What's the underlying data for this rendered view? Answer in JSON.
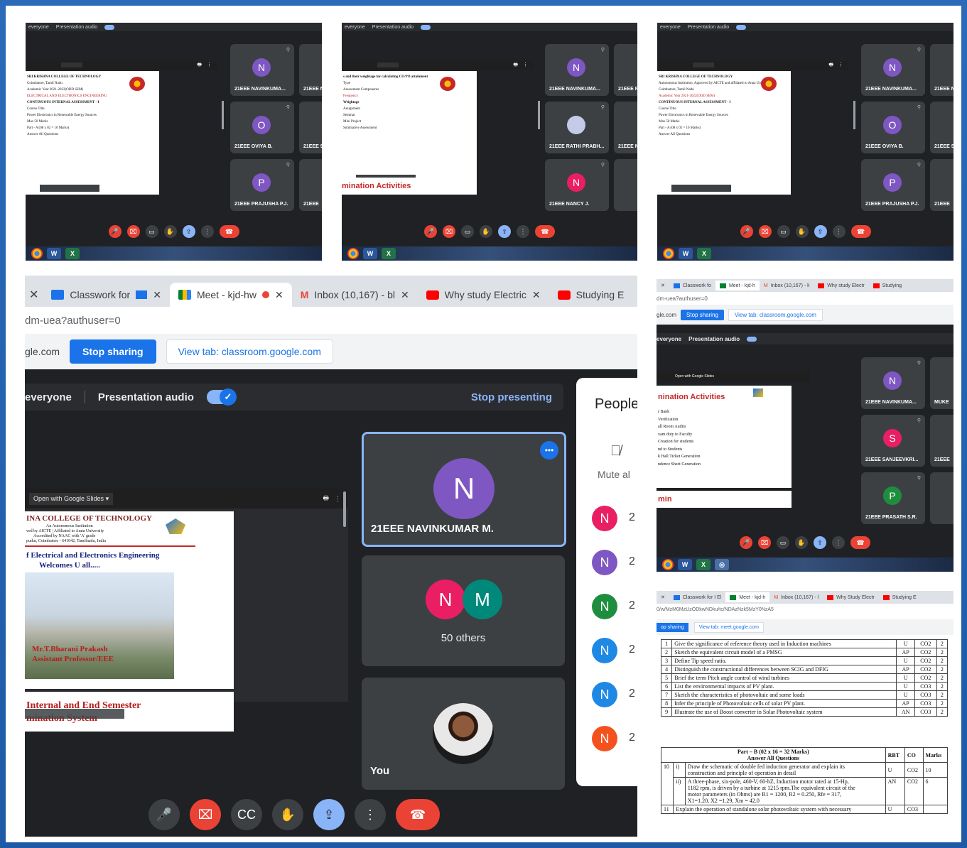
{
  "colors": {
    "accent": "#1a73e8",
    "danger": "#ea4335",
    "purple": "#7e57c2",
    "green": "#1e8e3e",
    "teal": "#00897b",
    "blue": "#1e88e5",
    "orange": "#f4511e",
    "pink": "#e91e63"
  },
  "meet_common": {
    "audience_label": "everyone",
    "presentation_audio": "Presentation audio",
    "open_with": "Open with Google Slides"
  },
  "top_panels": [
    {
      "doc_lines": [
        "SRI KRISHNA COLLEGE OF TECHNOLOGY",
        "Coimbatore, Tamil Nadu",
        "Academic Year 2021-2022(ODD SEM)",
        "ELECTRICAL AND ELECTRONICS ENGINEERING",
        "CONTINUOUS INTERNAL ASSESSMENT - I",
        "Course Title",
        "Power Electronics in Renewable Energy Sources",
        "Max 50 Marks",
        "Part - A (08 x 02 = 16 Marks)",
        "Answer All Questions"
      ],
      "tiles": [
        {
          "initial": "N",
          "name": "21EEE NAVINKUMA...",
          "color": "#7e57c2"
        },
        {
          "initial": "O",
          "name": "21EEE OVIYA B.",
          "color": "#7e57c2"
        },
        {
          "initial": "P",
          "name": "21EEE PRAJUSHA P.J.",
          "color": "#7e57c2"
        }
      ],
      "side": [
        "21EEE N",
        "21EEE S",
        "21EEE"
      ]
    },
    {
      "doc_lines": [
        "s and their weightage for calculating CO/PO attainment",
        "Type",
        "Assessment Components",
        "Frequency",
        "Weightage",
        "Assignment",
        "Seminar",
        "Mini Project",
        "Summative Assessment"
      ],
      "tiles": [
        {
          "initial": "N",
          "name": "21EEE NAVINKUMA...",
          "color": "#7e57c2"
        },
        {
          "initial": "",
          "name": "21EEE RATHI PRABH...",
          "color": "#c5cae9"
        },
        {
          "initial": "N",
          "name": "21EEE NANCY J.",
          "color": "#e91e63"
        }
      ],
      "side": [
        "21EEE P",
        "21EEE N",
        ""
      ],
      "heading": "mination Activities"
    },
    {
      "doc_lines": [
        "SRI KRISHNA COLLEGE OF TECHNOLOGY",
        "Autonomous Institution, Approved by AICTE and affiliated to Anna University",
        "Coimbatore, Tamil Nadu",
        "Academic Year 2021-2022(ODD SEM)",
        "CONTINUOUS INTERNAL ASSESSMENT - I",
        "Course Title",
        "Power Electronics in Renewable Energy Sources",
        "Max 50 Marks",
        "Part - A (08 x 02 = 16 Marks)",
        "Answer All Questions"
      ],
      "tiles": [
        {
          "initial": "N",
          "name": "21EEE NAVINKUMA...",
          "color": "#7e57c2"
        },
        {
          "initial": "O",
          "name": "21EEE OVIYA B.",
          "color": "#7e57c2"
        },
        {
          "initial": "P",
          "name": "21EEE PRAJUSHA P.J.",
          "color": "#7e57c2"
        }
      ],
      "side": [
        "21EEE N",
        "21EEE S",
        "21EEE"
      ]
    }
  ],
  "big_panel": {
    "tabs": [
      "Classwork for",
      "Meet - kjd-hw",
      "Inbox (10,167) - bl",
      "Why study Electric",
      "Studying E"
    ],
    "url": "dm-uea?authuser=0",
    "share_domain": "gle.com",
    "stop_sharing": "Stop sharing",
    "view_tab": "View tab: classroom.google.com",
    "audience": "everyone",
    "presentation_audio": "Presentation audio",
    "stop_presenting": "Stop presenting",
    "slide": {
      "college": "INA COLLEGE OF TECHNOLOGY",
      "line1": "An Autonomous Institution",
      "line2": "ved by AICTE | Affiliated to Anna University",
      "line3": "Accredited by NAAC with 'A' grade",
      "line4": "pudur, Coimbatore - 641042, Tamilnadu, India",
      "dept": "f Electrical and Electronics Engineering",
      "welcome": "Welcomes U all.....",
      "presenter": "Mr.T.Bharani Prakash",
      "role": "Assistant Professor/EEE",
      "footer": "Internal and End Semester",
      "footer2": "mination System"
    },
    "main_tile": {
      "initial": "N",
      "name": "21EEE NAVINKUMAR M.",
      "more": "•••"
    },
    "others_tile": {
      "initial1": "N",
      "initial2": "M",
      "label": "50 others"
    },
    "you_tile": {
      "label": "You"
    },
    "people": {
      "title": "People",
      "mute_label": "Mute al",
      "avatars": [
        {
          "initial": "N",
          "color": "#e91e63"
        },
        {
          "initial": "N",
          "color": "#7e57c2"
        },
        {
          "initial": "N",
          "color": "#1e8e3e"
        },
        {
          "initial": "N",
          "color": "#1e88e5"
        },
        {
          "initial": "N",
          "color": "#1e88e5"
        },
        {
          "initial": "N",
          "color": "#f4511e"
        }
      ],
      "count_prefix": "2"
    }
  },
  "right_mid_panel": {
    "tabs": [
      "Classwork fo",
      "Meet - kjd-h",
      "Inbox (10,167) - li",
      "Why study Electr",
      "Studying"
    ],
    "url": "dm-uea?authuser=0",
    "share_domain": "gle.com",
    "stop_sharing": "Stop sharing",
    "view_tab": "View tab: classroom.google.com",
    "heading": "nination Activities",
    "list": [
      "r Bank",
      "Verification",
      "all Room Audits",
      "xam duty to Faculty",
      "Creation for students",
      "nd to Students",
      "k Hall Ticket Generation",
      "ndence Sheet Generation"
    ],
    "footer_heading": "min",
    "tiles": [
      {
        "initial": "N",
        "name": "21EEE NAVINKUMA...",
        "color": "#7e57c2"
      },
      {
        "initial": "S",
        "name": "21EEE SANJEEVKRI...",
        "color": "#e91e63"
      },
      {
        "initial": "P",
        "name": "21EEE PRASATH S.R.",
        "color": "#1e8e3e"
      }
    ],
    "side": [
      "MUKE",
      "21EEE",
      ""
    ]
  },
  "exam_panel": {
    "tabs": [
      "Classwork for I El",
      "Meet - kjd-h",
      "Inbox (10,167) - l",
      "Why Study Electr",
      "Studying E"
    ],
    "url": "0/w/MzM0MzUzODkwNDku/tc/NDAzNzk5MzY0NzA5",
    "stop_sharing": "op sharing",
    "view_tab": "View tab: meet.google.com",
    "part_a": [
      {
        "no": "1",
        "q": "Give the significance of reference theory used in Induction machines",
        "rbt": "U",
        "co": "CO2",
        "marks": "2"
      },
      {
        "no": "2",
        "q": "Sketch the equivalent circuit model of a PMSG",
        "rbt": "AP",
        "co": "CO2",
        "marks": "2"
      },
      {
        "no": "3",
        "q": "Define Tip speed ratio.",
        "rbt": "U",
        "co": "CO2",
        "marks": "2"
      },
      {
        "no": "4",
        "q": "Distinguish the constructional differences between SCIG and DFIG",
        "rbt": "AP",
        "co": "CO2",
        "marks": "2"
      },
      {
        "no": "5",
        "q": "Brief the term Pitch angle control of wind turbines",
        "rbt": "U",
        "co": "CO2",
        "marks": "2"
      },
      {
        "no": "6",
        "q": "List the environmental impacts of PV plant.",
        "rbt": "U",
        "co": "CO3",
        "marks": "2"
      },
      {
        "no": "7",
        "q": "Sketch the characteristics of photovoltaic and some loads",
        "rbt": "U",
        "co": "CO3",
        "marks": "2"
      },
      {
        "no": "8",
        "q": "Infer the principle of Photovoltaic cells of solar PV plant.",
        "rbt": "AP",
        "co": "CO3",
        "marks": "2"
      },
      {
        "no": "9",
        "q": "Illustrate the use of Boost converter in Solar Photovoltaic system",
        "rbt": "AN",
        "co": "CO3",
        "marks": "2"
      }
    ],
    "part_b_title": "Part – B (02 x 16 = 32 Marks)",
    "part_b_sub": "Answer All Questions",
    "hdr": {
      "rbt": "RBT",
      "co": "CO",
      "marks": "Marks"
    },
    "q10": {
      "no": "10",
      "sub_i": "i)",
      "text_i": "Draw the schematic of double fed induction generator and explain its",
      "text_i2": "construction and principle of operation in detail",
      "rbt_i": "U",
      "co_i": "CO2",
      "marks_i": "10",
      "sub_ii": "ii)",
      "text_ii": "A three-phase, six-pole, 460-V, 60-hZ, Induction motor rated at 15-Hp,",
      "text_ii2": "1182 rpm, is driven by a turbine at 1215 rpm.The equivalent circuit of the",
      "text_ii3": "motor parameters (in Ohms) are R1 = 1200, R2 = 0.250, Rfe = 317,",
      "text_ii4": "X1=1.20, X2 =1.29, Xm = 42.0",
      "rbt_ii": "AN",
      "co_ii": "CO2",
      "marks_ii": "6"
    },
    "q11": {
      "no": "11",
      "text": "Explain the operation of standalone solar photovoltaic system with necessary",
      "rbt": "U",
      "co": "CO3"
    }
  }
}
